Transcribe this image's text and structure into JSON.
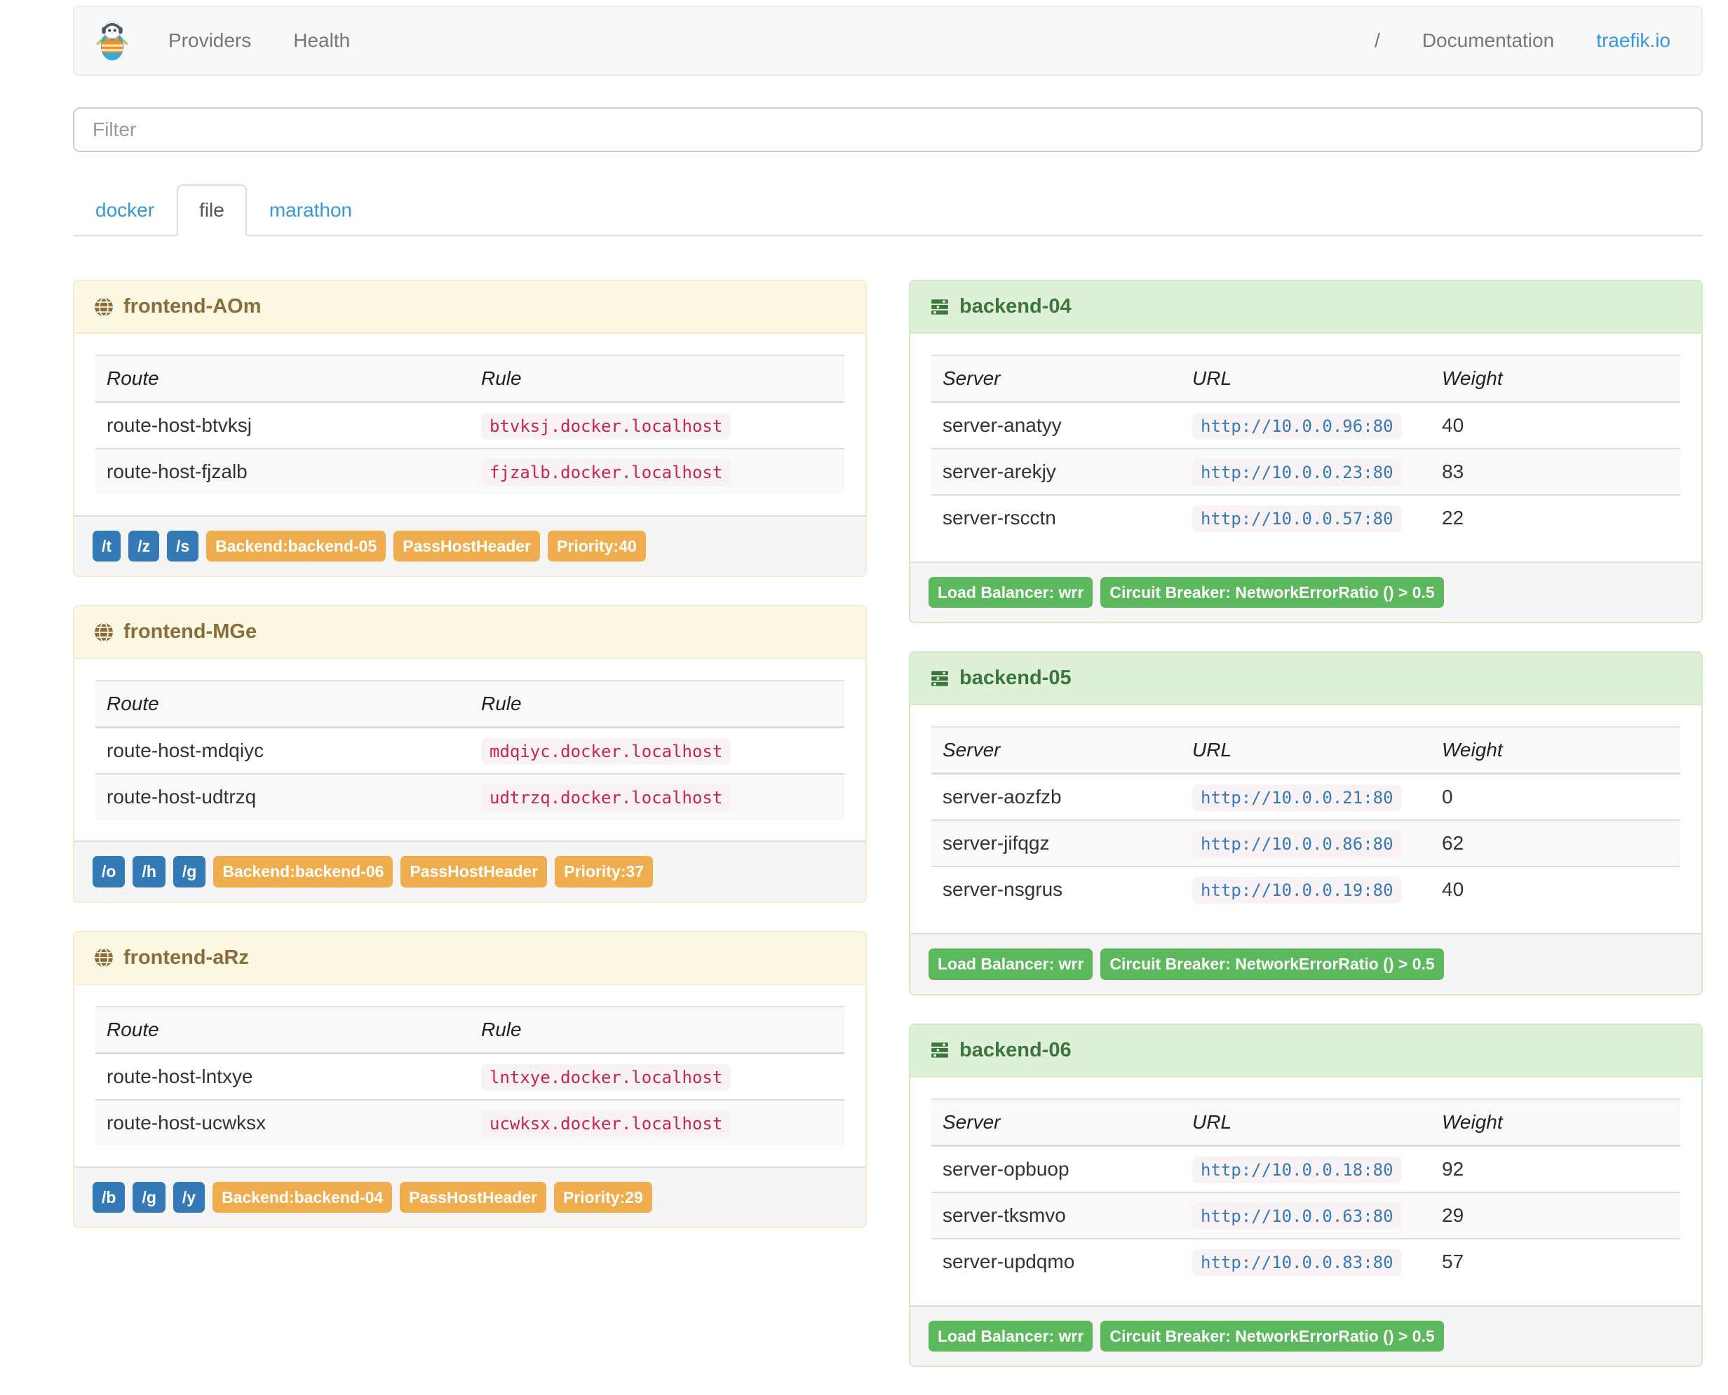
{
  "header": {
    "brand_icon": "traefik-logo",
    "nav_left": [
      {
        "label": "Providers"
      },
      {
        "label": "Health"
      }
    ],
    "nav_right": [
      {
        "label": "/"
      },
      {
        "label": "Documentation"
      },
      {
        "label": "traefik.io"
      }
    ]
  },
  "filter": {
    "placeholder": "Filter"
  },
  "tabs": [
    {
      "label": "docker",
      "active": false
    },
    {
      "label": "file",
      "active": true
    },
    {
      "label": "marathon",
      "active": false
    }
  ],
  "frontends": [
    {
      "name": "frontend-AOm",
      "columns": [
        "Route",
        "Rule"
      ],
      "routes": [
        {
          "route": "route-host-btvksj",
          "rule": "btvksj.docker.localhost"
        },
        {
          "route": "route-host-fjzalb",
          "rule": "fjzalb.docker.localhost"
        }
      ],
      "tags": [
        {
          "text": "/t",
          "type": "primary"
        },
        {
          "text": "/z",
          "type": "primary"
        },
        {
          "text": "/s",
          "type": "primary"
        },
        {
          "text": "Backend:backend-05",
          "type": "warning"
        },
        {
          "text": "PassHostHeader",
          "type": "warning"
        },
        {
          "text": "Priority:40",
          "type": "warning"
        }
      ]
    },
    {
      "name": "frontend-MGe",
      "columns": [
        "Route",
        "Rule"
      ],
      "routes": [
        {
          "route": "route-host-mdqiyc",
          "rule": "mdqiyc.docker.localhost"
        },
        {
          "route": "route-host-udtrzq",
          "rule": "udtrzq.docker.localhost"
        }
      ],
      "tags": [
        {
          "text": "/o",
          "type": "primary"
        },
        {
          "text": "/h",
          "type": "primary"
        },
        {
          "text": "/g",
          "type": "primary"
        },
        {
          "text": "Backend:backend-06",
          "type": "warning"
        },
        {
          "text": "PassHostHeader",
          "type": "warning"
        },
        {
          "text": "Priority:37",
          "type": "warning"
        }
      ]
    },
    {
      "name": "frontend-aRz",
      "columns": [
        "Route",
        "Rule"
      ],
      "routes": [
        {
          "route": "route-host-lntxye",
          "rule": "lntxye.docker.localhost"
        },
        {
          "route": "route-host-ucwksx",
          "rule": "ucwksx.docker.localhost"
        }
      ],
      "tags": [
        {
          "text": "/b",
          "type": "primary"
        },
        {
          "text": "/g",
          "type": "primary"
        },
        {
          "text": "/y",
          "type": "primary"
        },
        {
          "text": "Backend:backend-04",
          "type": "warning"
        },
        {
          "text": "PassHostHeader",
          "type": "warning"
        },
        {
          "text": "Priority:29",
          "type": "warning"
        }
      ]
    }
  ],
  "backends": [
    {
      "name": "backend-04",
      "columns": [
        "Server",
        "URL",
        "Weight"
      ],
      "servers": [
        {
          "server": "server-anatyy",
          "url": "http://10.0.0.96:80",
          "weight": "40"
        },
        {
          "server": "server-arekjy",
          "url": "http://10.0.0.23:80",
          "weight": "83"
        },
        {
          "server": "server-rscctn",
          "url": "http://10.0.0.57:80",
          "weight": "22"
        }
      ],
      "tags": [
        {
          "text": "Load Balancer: wrr",
          "type": "success"
        },
        {
          "text": "Circuit Breaker: NetworkErrorRatio () > 0.5",
          "type": "success"
        }
      ]
    },
    {
      "name": "backend-05",
      "columns": [
        "Server",
        "URL",
        "Weight"
      ],
      "servers": [
        {
          "server": "server-aozfzb",
          "url": "http://10.0.0.21:80",
          "weight": "0"
        },
        {
          "server": "server-jifqgz",
          "url": "http://10.0.0.86:80",
          "weight": "62"
        },
        {
          "server": "server-nsgrus",
          "url": "http://10.0.0.19:80",
          "weight": "40"
        }
      ],
      "tags": [
        {
          "text": "Load Balancer: wrr",
          "type": "success"
        },
        {
          "text": "Circuit Breaker: NetworkErrorRatio () > 0.5",
          "type": "success"
        }
      ]
    },
    {
      "name": "backend-06",
      "columns": [
        "Server",
        "URL",
        "Weight"
      ],
      "servers": [
        {
          "server": "server-opbuop",
          "url": "http://10.0.0.18:80",
          "weight": "92"
        },
        {
          "server": "server-tksmvo",
          "url": "http://10.0.0.63:80",
          "weight": "29"
        },
        {
          "server": "server-updqmo",
          "url": "http://10.0.0.83:80",
          "weight": "57"
        }
      ],
      "tags": [
        {
          "text": "Load Balancer: wrr",
          "type": "success"
        },
        {
          "text": "Circuit Breaker: NetworkErrorRatio () > 0.5",
          "type": "success"
        }
      ]
    }
  ],
  "colors": {
    "link": "#3498db",
    "navbar_bg": "#f8f8f8",
    "nav_text": "#777777",
    "label_primary": "#337ab7",
    "label_warning": "#f0ad4e",
    "label_success": "#5cb85c",
    "frontend_heading_bg": "#fcf8e3",
    "frontend_heading_text": "#8a6d3b",
    "frontend_border": "#faebcc",
    "backend_heading_bg": "#dff0d8",
    "backend_heading_text": "#3c763d",
    "backend_border": "#d6e9c6",
    "rule_code_text": "#c7254e",
    "url_code_text": "#337ab7",
    "code_bg": "#f9f2f4",
    "footer_bg": "#f5f5f5",
    "table_stripe": "#f9f9f9"
  }
}
